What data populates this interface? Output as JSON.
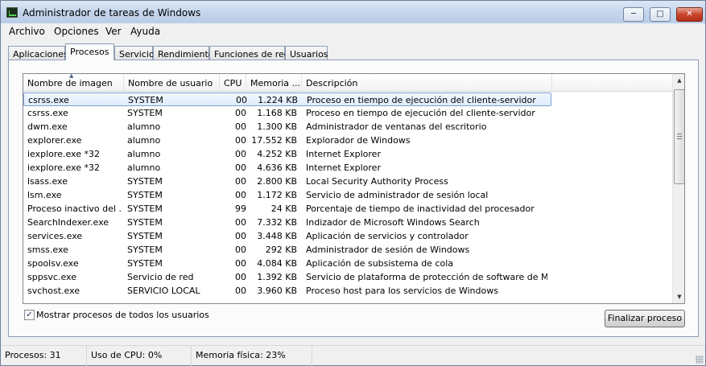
{
  "window": {
    "title": "Administrador de tareas de Windows",
    "buttons": {
      "minimize": "─",
      "maximize": "□",
      "close": "✕"
    }
  },
  "menu": [
    "Archivo",
    "Opciones",
    "Ver",
    "Ayuda"
  ],
  "tabs": [
    {
      "label": "Aplicaciones",
      "active": false
    },
    {
      "label": "Procesos",
      "active": true
    },
    {
      "label": "Servicios",
      "active": false
    },
    {
      "label": "Rendimiento",
      "active": false
    },
    {
      "label": "Funciones de red",
      "active": false
    },
    {
      "label": "Usuarios",
      "active": false
    }
  ],
  "columns": {
    "name": "Nombre de imagen",
    "user": "Nombre de usuario",
    "cpu": "CPU",
    "mem": "Memoria ...",
    "desc": "Descripción"
  },
  "rows": [
    {
      "name": "csrss.exe",
      "user": "SYSTEM",
      "cpu": "00",
      "mem": "1.224 KB",
      "desc": "Proceso en tiempo de ejecución del cliente-servidor",
      "selected": true
    },
    {
      "name": "csrss.exe",
      "user": "SYSTEM",
      "cpu": "00",
      "mem": "1.168 KB",
      "desc": "Proceso en tiempo de ejecución del cliente-servidor"
    },
    {
      "name": "dwm.exe",
      "user": "alumno",
      "cpu": "00",
      "mem": "1.300 KB",
      "desc": "Administrador de ventanas del escritorio"
    },
    {
      "name": "explorer.exe",
      "user": "alumno",
      "cpu": "00",
      "mem": "17.552 KB",
      "desc": "Explorador de Windows"
    },
    {
      "name": "iexplore.exe *32",
      "user": "alumno",
      "cpu": "00",
      "mem": "4.252 KB",
      "desc": "Internet Explorer"
    },
    {
      "name": "iexplore.exe *32",
      "user": "alumno",
      "cpu": "00",
      "mem": "4.636 KB",
      "desc": "Internet Explorer"
    },
    {
      "name": "lsass.exe",
      "user": "SYSTEM",
      "cpu": "00",
      "mem": "2.800 KB",
      "desc": "Local Security Authority Process"
    },
    {
      "name": "lsm.exe",
      "user": "SYSTEM",
      "cpu": "00",
      "mem": "1.172 KB",
      "desc": "Servicio de administrador de sesión local"
    },
    {
      "name": "Proceso inactivo del ...",
      "user": "SYSTEM",
      "cpu": "99",
      "mem": "24 KB",
      "desc": "Porcentaje de tiempo de inactividad del procesador"
    },
    {
      "name": "SearchIndexer.exe",
      "user": "SYSTEM",
      "cpu": "00",
      "mem": "7.332 KB",
      "desc": "Indizador de Microsoft Windows Search"
    },
    {
      "name": "services.exe",
      "user": "SYSTEM",
      "cpu": "00",
      "mem": "3.448 KB",
      "desc": "Aplicación de servicios y controlador"
    },
    {
      "name": "smss.exe",
      "user": "SYSTEM",
      "cpu": "00",
      "mem": "292 KB",
      "desc": "Administrador de sesión de Windows"
    },
    {
      "name": "spoolsv.exe",
      "user": "SYSTEM",
      "cpu": "00",
      "mem": "4.084 KB",
      "desc": "Aplicación de subsistema de cola"
    },
    {
      "name": "sppsvc.exe",
      "user": "Servicio de red",
      "cpu": "00",
      "mem": "1.392 KB",
      "desc": "Servicio de plataforma de protección de software de Micros..."
    },
    {
      "name": "svchost.exe",
      "user": "SERVICIO LOCAL",
      "cpu": "00",
      "mem": "3.960 KB",
      "desc": "Proceso host para los servicios de Windows"
    }
  ],
  "show_all_users": {
    "label": "Mostrar procesos de todos los usuarios",
    "checked": true,
    "mark": "✓"
  },
  "end_process_label": "Finalizar proceso",
  "status": {
    "processes": "Procesos: 31",
    "cpu": "Uso de CPU: 0%",
    "memory": "Memoria física: 23%"
  },
  "icons": {
    "sort_up": "▲",
    "scroll_up": "▲",
    "scroll_down": "▼"
  }
}
